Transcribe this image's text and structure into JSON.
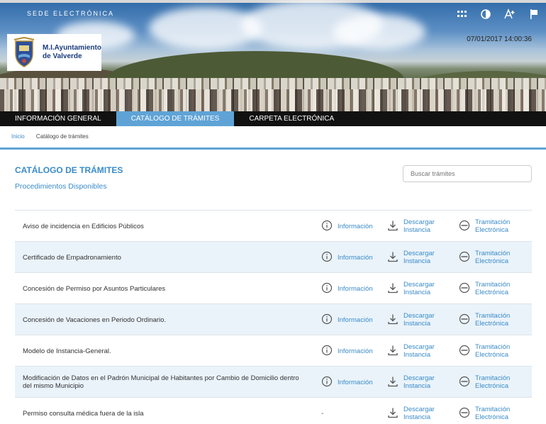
{
  "header": {
    "sede_label": "SEDE ELECTRÓNICA",
    "datetime": "07/01/2017 14:00:36",
    "logo_line1": "M.I.Ayuntamiento",
    "logo_line2": "de Valverde",
    "icons": [
      "sitemap-icon",
      "contrast-icon",
      "font-size-icon",
      "flag-icon"
    ]
  },
  "nav": {
    "items": [
      {
        "label": "INFORMACIÓN GENERAL"
      },
      {
        "label": "CATÁLOGO DE TRÁMITES"
      },
      {
        "label": "CARPETA ELECTRÓNICA"
      }
    ],
    "active_index": 1
  },
  "breadcrumb": {
    "home": "Inicio",
    "current": "Catálogo de trámites"
  },
  "page": {
    "title": "CATÁLOGO DE TRÁMITES",
    "subtitle": "Procedimientos Disponibles",
    "search_placeholder": "Buscar trámites"
  },
  "columns": {
    "info": "Información",
    "download_line1": "Descargar",
    "download_line2": "Instancia",
    "tramit_line1": "Tramitación",
    "tramit_line2": "Electrónica",
    "no_info": "-"
  },
  "procedures": [
    {
      "name": "Aviso de incidencia en Edificios Públicos"
    },
    {
      "name": "Certificado de Empadronamiento"
    },
    {
      "name": "Concesión de Permiso por Asuntos Particulares"
    },
    {
      "name": "Concesión de Vacaciones en Periodo Ordinario."
    },
    {
      "name": "Modelo de Instancia-General."
    },
    {
      "name": "Modificación de Datos en el Padrón Municipal de Habitantes por Cambio de Domicilio dentro del mismo Municipio"
    },
    {
      "name": "Permiso consulta médica fuera de la isla"
    }
  ],
  "colors": {
    "accent": "#5fa3d6",
    "link": "#3a8bc9",
    "nav_bg": "#111111",
    "row_alt": "#eaf3fa"
  }
}
